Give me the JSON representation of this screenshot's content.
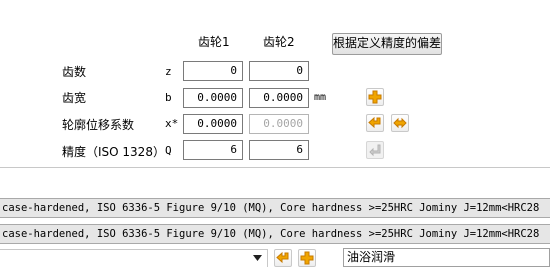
{
  "columns": {
    "gear1": "齿轮1",
    "gear2": "齿轮2"
  },
  "custom_button_label": "根据定义精度的偏差",
  "rows": [
    {
      "label": "齿数",
      "symbol": "z",
      "gear1": "0",
      "gear2": "0",
      "unit": ""
    },
    {
      "label": "齿宽",
      "symbol": "b",
      "gear1": "0.0000",
      "gear2": "0.0000",
      "unit": "mm"
    },
    {
      "label": "轮廓位移系数",
      "symbol": "x*",
      "gear1": "0.0000",
      "gear2": "0.0000",
      "unit": ""
    },
    {
      "label": "精度（ISO 1328）",
      "symbol": "Q",
      "gear1": "6",
      "gear2": "6",
      "unit": ""
    }
  ],
  "material_lines": [
    "case-hardened, ISO 6336-5 Figure 9/10 (MQ), Core hardness >=25HRC Jominy J=12mm<HRC28",
    "case-hardened, ISO 6336-5 Figure 9/10 (MQ), Core hardness >=25HRC Jominy J=12mm<HRC28"
  ],
  "lubrication": {
    "value": "油浴润滑"
  },
  "colors": {
    "icon_orange": "#f0a500",
    "icon_orange_dark": "#c77a00",
    "strip_bg": "#e6e6e6"
  },
  "icons": [
    "plus-icon",
    "arrow-left-icon",
    "swap-arrows-icon",
    "arrow-return-icon",
    "chevron-down-icon"
  ]
}
